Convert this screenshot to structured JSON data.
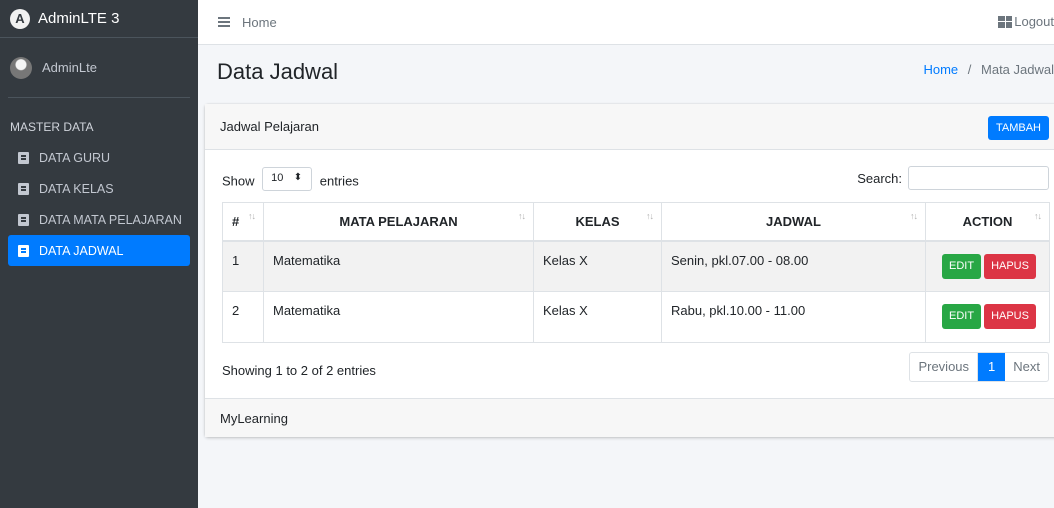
{
  "brand": {
    "text": "AdminLTE 3",
    "logo_letter": "A"
  },
  "user": {
    "name": "AdminLte"
  },
  "sidebar": {
    "header": "MASTER DATA",
    "items": [
      {
        "label": "DATA GURU",
        "active": false
      },
      {
        "label": "DATA KELAS",
        "active": false
      },
      {
        "label": "DATA MATA PELAJARAN",
        "active": false
      },
      {
        "label": "DATA JADWAL",
        "active": true
      }
    ]
  },
  "navbar": {
    "home": "Home",
    "logout": "Logout"
  },
  "page": {
    "title": "Data Jadwal"
  },
  "breadcrumb": {
    "home": "Home",
    "separator": "/",
    "current": "Mata Jadwal"
  },
  "card": {
    "title": "Jadwal Pelajaran",
    "add_button": "TAMBAH",
    "footer": "MyLearning"
  },
  "table_controls": {
    "show_label": "Show",
    "entries_value": "10",
    "entries_label": "entries",
    "search_label": "Search:",
    "search_value": ""
  },
  "table": {
    "headers": [
      "#",
      "MATA PELAJARAN",
      "KELAS",
      "JADWAL",
      "ACTION"
    ],
    "rows": [
      {
        "no": "1",
        "mapel": "Matematika",
        "kelas": "Kelas X",
        "jadwal": "Senin, pkl.07.00 - 08.00"
      },
      {
        "no": "2",
        "mapel": "Matematika",
        "kelas": "Kelas X",
        "jadwal": "Rabu, pkl.10.00 - 11.00"
      }
    ],
    "edit_label": "EDIT",
    "delete_label": "HAPUS"
  },
  "pagination": {
    "info": "Showing 1 to 2 of 2 entries",
    "previous": "Previous",
    "current": "1",
    "next": "Next"
  },
  "colors": {
    "primary": "#007bff",
    "success": "#28a745",
    "danger": "#dc3545",
    "sidebar": "#343a40"
  }
}
